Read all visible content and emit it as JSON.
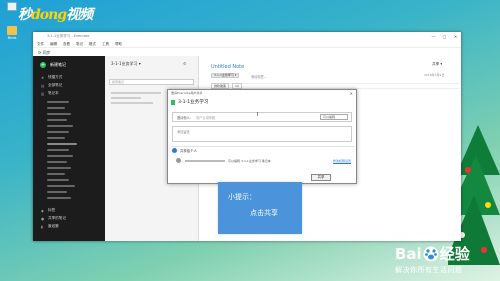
{
  "desktop": {
    "watermark": {
      "prefix": "秒",
      "highlight": "dong",
      "suffix": "视频"
    },
    "icons": [
      {
        "label": "",
        "icon": "recycle-bin-icon"
      },
      {
        "label": "Birds",
        "icon": "folder-icon"
      }
    ]
  },
  "window": {
    "title": "3-1-1业务学习 - Evernote",
    "menu": [
      "文件",
      "编辑",
      "查看",
      "笔记",
      "格式",
      "工具",
      "帮助"
    ],
    "toolbar_sync": "同步",
    "controls": [
      "—",
      "□",
      "✕"
    ]
  },
  "sidebar": {
    "new_note": "新建笔记",
    "items_top": [
      "快捷方式",
      "全部笔记",
      "笔记本"
    ],
    "items_bottom": [
      "标签",
      "共享的笔记",
      "废纸篓"
    ]
  },
  "list_pane": {
    "title": "3-1-1业务学习 ▾",
    "search_placeholder": "搜索笔记"
  },
  "editor": {
    "title": "Untitled Note",
    "notebook_tag": "3-1-1业务学习 ▾",
    "tag_hint": "添加标签...",
    "share": "共享 ▾",
    "font": "微软雅黑",
    "font_size": "10",
    "date_hint": "2018年3月9日"
  },
  "dialog": {
    "window_title": "邀请Evernote用户共享",
    "notebook_name": "3-1-1业务学习",
    "invite_label": "邀请他人：",
    "invite_placeholder": "用户名或邮箱",
    "permission": "可以编辑",
    "message_placeholder": "添加留言",
    "shared_with": "共享给个人",
    "shared_row_text": "可以编辑 3-1-1业务学习 笔记本",
    "shared_row_link": "修改权限设置",
    "done_button": "共享"
  },
  "tip": {
    "title": "小提示：",
    "text": "点击共享"
  },
  "baidu": {
    "left": "Bai",
    "right": "经验",
    "slogan": "解决你所有生活问题"
  }
}
